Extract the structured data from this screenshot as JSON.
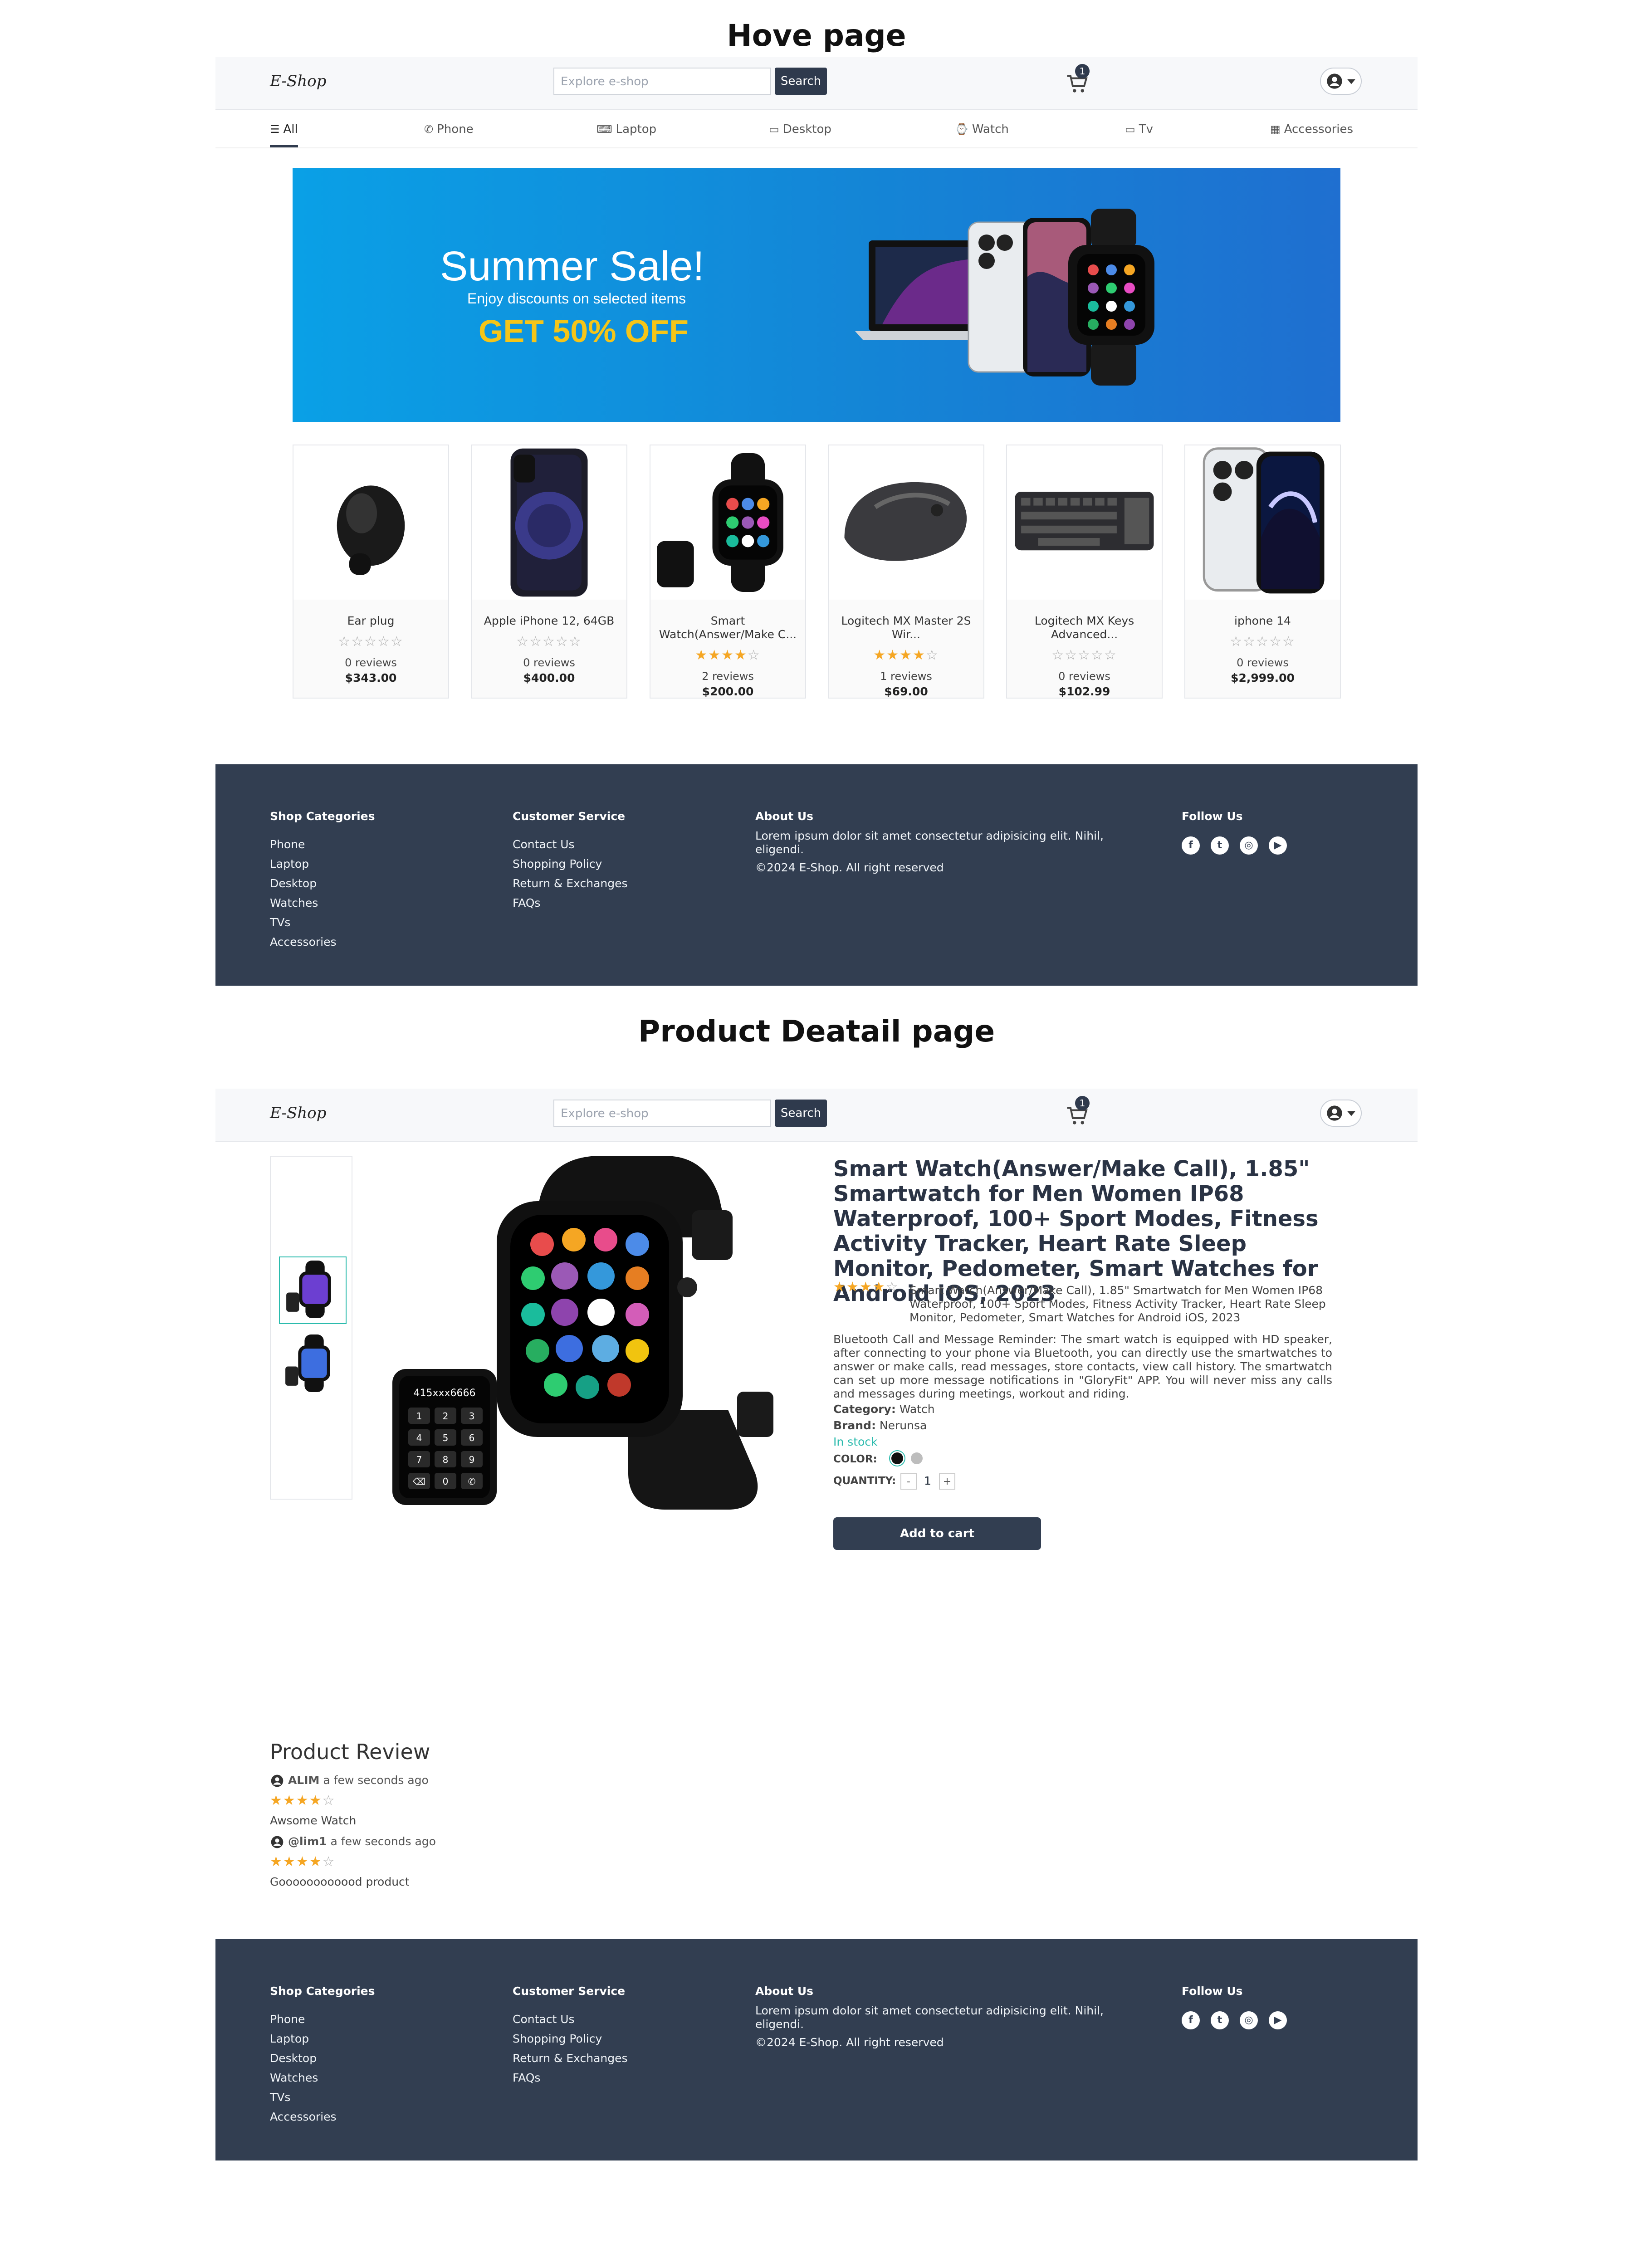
{
  "sections": {
    "home_title": "Hove page",
    "detail_title": "Product Deatail page"
  },
  "header": {
    "logo": "E-Shop",
    "search_placeholder": "Explore e-shop",
    "search_button": "Search",
    "cart_count": "1"
  },
  "categories": [
    {
      "label": "All",
      "icon": "list-icon"
    },
    {
      "label": "Phone",
      "icon": "phone-icon"
    },
    {
      "label": "Laptop",
      "icon": "laptop-icon"
    },
    {
      "label": "Desktop",
      "icon": "desktop-icon"
    },
    {
      "label": "Watch",
      "icon": "watch-icon"
    },
    {
      "label": "Tv",
      "icon": "tv-icon"
    },
    {
      "label": "Accessories",
      "icon": "calendar-icon"
    }
  ],
  "banner": {
    "title": "Summer Sale!",
    "subtitle": "Enjoy discounts on selected items",
    "offer": "GET 50% OFF"
  },
  "products": [
    {
      "name": "Ear plug",
      "rating": 0,
      "reviews": "0 reviews",
      "price": "$343.00"
    },
    {
      "name": "Apple iPhone 12, 64GB",
      "rating": 0,
      "reviews": "0 reviews",
      "price": "$400.00"
    },
    {
      "name": "Smart Watch(Answer/Make C...",
      "rating": 4,
      "reviews": "2 reviews",
      "price": "$200.00"
    },
    {
      "name": "Logitech MX Master 2S Wir...",
      "rating": 4,
      "reviews": "1 reviews",
      "price": "$69.00"
    },
    {
      "name": "Logitech MX Keys Advanced...",
      "rating": 0,
      "reviews": "0 reviews",
      "price": "$102.99"
    },
    {
      "name": "iphone 14",
      "rating": 0,
      "reviews": "0 reviews",
      "price": "$2,999.00"
    }
  ],
  "footer": {
    "shop_head": "Shop Categories",
    "shop_links": [
      "Phone",
      "Laptop",
      "Desktop",
      "Watches",
      "TVs",
      "Accessories"
    ],
    "service_head": "Customer Service",
    "service_links": [
      "Contact Us",
      "Shopping Policy",
      "Return & Exchanges",
      "FAQs"
    ],
    "about_head": "About Us",
    "about_text": "Lorem ipsum dolor sit amet consectetur adipisicing elit. Nihil, eligendi.",
    "copyright": "©2024 E-Shop. All right reserved",
    "follow_head": "Follow Us",
    "social": [
      "facebook-icon",
      "twitter-icon",
      "instagram-icon",
      "youtube-icon"
    ]
  },
  "detail": {
    "title": "Smart Watch(Answer/Make Call), 1.85\" Smartwatch for Men Women IP68 Waterproof, 100+ Sport Modes, Fitness Activity Tracker, Heart Rate Sleep Monitor, Pedometer, Smart Watches for Android iOS, 2023",
    "rating": 4,
    "short_desc": "Smart Watch(Answer/Make Call), 1.85\" Smartwatch for Men Women IP68 Waterproof, 100+ Sport Modes, Fitness Activity Tracker, Heart Rate Sleep Monitor, Pedometer, Smart Watches for Android iOS, 2023",
    "description": "Bluetooth Call and Message Reminder: The smart watch is equipped with HD speaker, after connecting to your phone via Bluetooth, you can directly use the smartwatches to answer or make calls, read messages, store contacts, view call history. The smartwatch can set up more message notifications in \"GloryFit\" APP. You will never miss any calls and messages during meetings, workout and riding.",
    "category_label": "Category:",
    "category": "Watch",
    "brand_label": "Brand:",
    "brand": "Nerunsa",
    "stock": "In stock",
    "color_label": "COLOR:",
    "quantity_label": "QUANTITY:",
    "quantity": "1",
    "minus": "-",
    "plus": "+",
    "add_to_cart": "Add to cart",
    "phone_number": "415xxx6666",
    "keypad": [
      "1",
      "2",
      "3",
      "4",
      "5",
      "6",
      "7",
      "8",
      "9",
      "⌫",
      "0",
      "✆"
    ]
  },
  "reviews": {
    "title": "Product Review",
    "items": [
      {
        "user": "ALIM",
        "time": "a few seconds ago",
        "rating": 4,
        "comment": "Awsome Watch"
      },
      {
        "user": "@lim1",
        "time": "a few seconds ago",
        "rating": 4,
        "comment": "Goooooooooood product"
      }
    ]
  },
  "colors": {
    "accent": "#323e51",
    "star": "#f5a623",
    "stock": "#2bbbad",
    "banner": "#0aa0e6"
  }
}
